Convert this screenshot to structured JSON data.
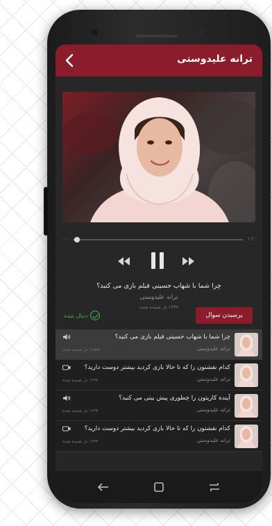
{
  "header": {
    "title": "ترانه علیدوستی",
    "back_icon": "chevron-left-icon"
  },
  "player": {
    "time_current": "۰:۰۰",
    "time_total": "۱:۲۰",
    "progress_fraction": 0.02,
    "question": "چرا شما با شهاب حسینی فیلم بازی می کنید؟",
    "author": "ترانه علیدوستی",
    "listens": "۱۲۳۹ بار شنیده شده"
  },
  "actions": {
    "ask_label": "پرسیدن سوال",
    "follow_label": "دنبال شده"
  },
  "list": {
    "items": [
      {
        "title": "چرا شما با شهاب حسینی فیلم بازی می کنید؟",
        "author": "ترانه علیدوستی",
        "listens": "۱۶۸۸۲ بار شنیده شده",
        "type_icon": "audio-icon"
      },
      {
        "title": "کدام نقشتون را که تا حالا بازی کردید بیشتر دوست دارید؟",
        "author": "ترانه علیدوستی",
        "listens": "۱۲۳۴ بار شنیده شده",
        "type_icon": "video-icon"
      },
      {
        "title": "آینده کاریتون را چطوری پیش بینی می کنید؟",
        "author": "ترانه علیدوستی",
        "listens": "۱۲۳۴ بار شنیده شده",
        "type_icon": "audio-icon"
      },
      {
        "title": "کدام نقشتون را که تا حالا بازی کردید بیشتر دوست دارید؟",
        "author": "ترانه علیدوستی",
        "listens": "۱۲۳۴ بار شنیده شده",
        "type_icon": "video-icon"
      }
    ]
  },
  "colors": {
    "accent": "#8b1c2c",
    "follow": "#4caf50",
    "background": "#262626"
  }
}
